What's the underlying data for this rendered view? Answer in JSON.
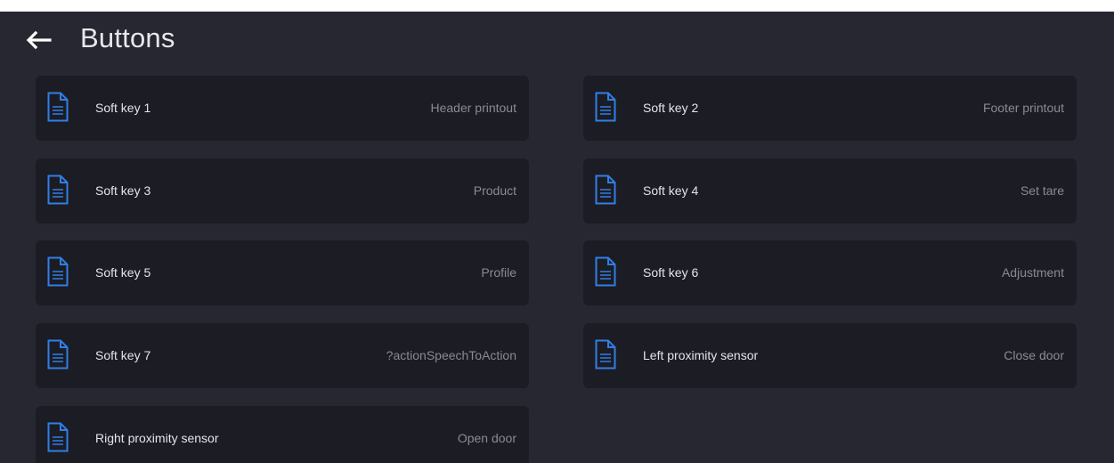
{
  "header": {
    "title": "Buttons",
    "back_icon": "arrow-left-icon"
  },
  "colors": {
    "background": "#272731",
    "tile": "#1c1c24",
    "accent": "#2f7fe6",
    "label": "#e4e4ea",
    "value": "#8a8a94"
  },
  "items": [
    {
      "label": "Soft key 1",
      "value": "Header printout",
      "icon": "document-icon"
    },
    {
      "label": "Soft key 2",
      "value": "Footer printout",
      "icon": "document-icon"
    },
    {
      "label": "Soft key 3",
      "value": "Product",
      "icon": "document-icon"
    },
    {
      "label": "Soft key 4",
      "value": "Set tare",
      "icon": "document-icon"
    },
    {
      "label": "Soft key 5",
      "value": "Profile",
      "icon": "document-icon"
    },
    {
      "label": "Soft key 6",
      "value": "Adjustment",
      "icon": "document-icon"
    },
    {
      "label": "Soft key 7",
      "value": "?actionSpeechToAction",
      "icon": "document-icon"
    },
    {
      "label": "Left proximity sensor",
      "value": "Close door",
      "icon": "document-icon"
    },
    {
      "label": "Right proximity sensor",
      "value": "Open door",
      "icon": "document-icon"
    }
  ]
}
